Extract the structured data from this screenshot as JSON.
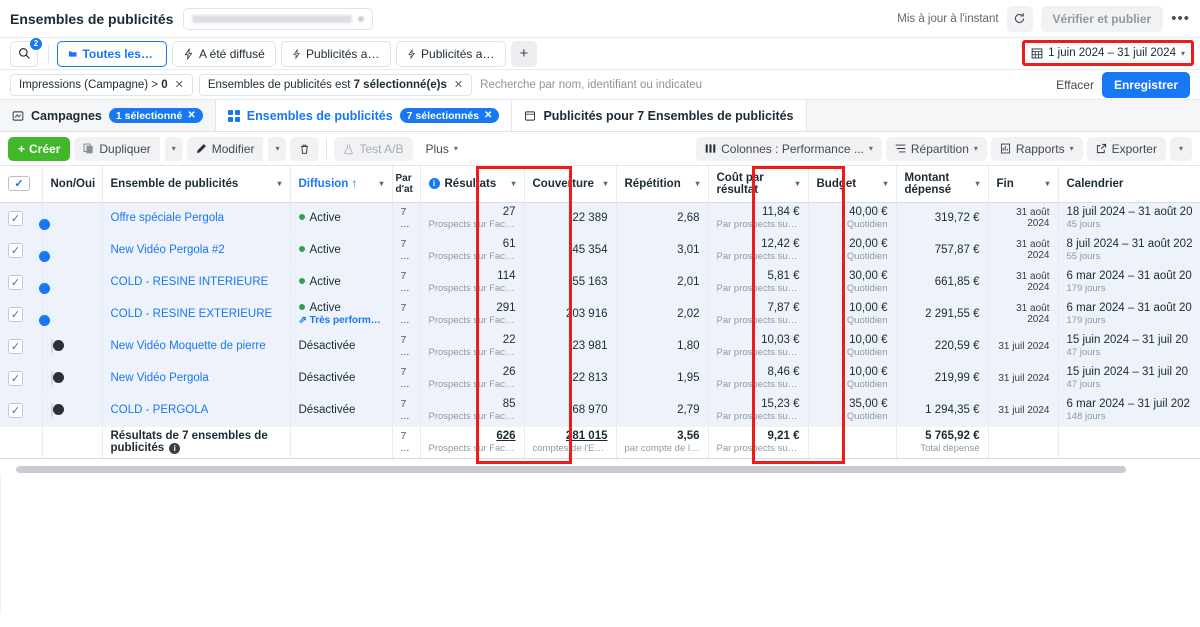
{
  "header": {
    "title": "Ensembles de publicités",
    "account_chip_blurred": true,
    "updated_text": "Mis à jour à l'instant",
    "refresh_icon": "refresh-icon",
    "publish_label": "Vérifier et publier",
    "more_label": "•••"
  },
  "filterbar": {
    "search_icon": "search-icon",
    "search_badge": "2",
    "chips": [
      {
        "icon": "folder-icon",
        "label": "Toutes les pub...",
        "active": true
      },
      {
        "icon": "bolt-icon",
        "label": "A été diffusé",
        "active": false
      },
      {
        "icon": "bolt-icon",
        "label": "Publicités activ...",
        "active": false
      },
      {
        "icon": "bolt-icon",
        "label": "Publicités activ...",
        "active": false
      }
    ],
    "add_label": "+",
    "date_range": {
      "icon": "calendar-icon",
      "label": "1 juin 2024 – 31 juil 2024",
      "caret": "▾",
      "highlighted": true
    }
  },
  "tokenrow": {
    "tokens": [
      {
        "text": "Impressions (Campagne) > ",
        "bold": "0"
      },
      {
        "text": "Ensembles de publicités est ",
        "bold": "7 sélectionné(e)s"
      }
    ],
    "search_placeholder": "Recherche par nom, identifiant ou indicateu",
    "clear_label": "Effacer",
    "save_label": "Enregistrer"
  },
  "tabs": [
    {
      "icon": "campaign-icon",
      "label": "Campagnes",
      "pill": "1 sélectionné",
      "selected": false
    },
    {
      "icon": "adset-grid-icon",
      "label": "Ensembles de publicités",
      "pill": "7 sélectionnés",
      "selected": true
    },
    {
      "icon": "ads-icon",
      "label": "Publicités pour 7 Ensembles de publicités",
      "pill": "",
      "selected": false
    }
  ],
  "toolbar": {
    "create_label": "Créer",
    "duplicate_label": "Dupliquer",
    "edit_label": "Modifier",
    "delete_icon": "trash-icon",
    "ab_test_label": "Test A/B",
    "more_label": "Plus",
    "columns_label": "Colonnes : Performance ...",
    "breakdown_label": "Répartition",
    "reports_label": "Rapports",
    "export_label": "Exporter"
  },
  "table": {
    "columns": [
      {
        "key": "check",
        "label": "",
        "sortable": false
      },
      {
        "key": "onoff",
        "label": "Non/Oui",
        "sortable": false
      },
      {
        "key": "name",
        "label": "Ensemble de publicités",
        "sortable": true
      },
      {
        "key": "delivery",
        "label": "Diffusion ↑",
        "sortable": true,
        "link": true
      },
      {
        "key": "attrib",
        "label": "Par d'at",
        "sortable": false
      },
      {
        "key": "results",
        "label": "Résultats",
        "sortable": true,
        "info": true,
        "highlighted": true
      },
      {
        "key": "reach",
        "label": "Couverture",
        "sortable": true
      },
      {
        "key": "freq",
        "label": "Répétition",
        "sortable": true
      },
      {
        "key": "cpr",
        "label": "Coût par résultat",
        "sortable": true,
        "highlighted": true
      },
      {
        "key": "budget",
        "label": "Budget",
        "sortable": true
      },
      {
        "key": "spent",
        "label": "Montant dépensé",
        "sortable": true
      },
      {
        "key": "end",
        "label": "Fin",
        "sortable": true
      },
      {
        "key": "schedule",
        "label": "Calendrier",
        "sortable": false
      }
    ],
    "rows": [
      {
        "checked": true,
        "toggle": "on",
        "name": "Offre spéciale Pergola",
        "delivery": "Active",
        "delivery_state": "active",
        "badge": "",
        "attrib": "7 ...",
        "results": "27",
        "results_sub": "Prospects sur Face...",
        "reach": "22 389",
        "freq": "2,68",
        "cpr": "11,84 €",
        "cpr_sub": "Par prospects sur F...",
        "budget": "40,00 €",
        "budget_sub": "Quotidien",
        "spent": "319,72 €",
        "end": "31 août 2024",
        "schedule": "18 juil 2024 – 31 août 20",
        "schedule_sub": "45 jours"
      },
      {
        "checked": true,
        "toggle": "on",
        "name": "New Vidéo Pergola #2",
        "delivery": "Active",
        "delivery_state": "active",
        "badge": "",
        "attrib": "7 ...",
        "results": "61",
        "results_sub": "Prospects sur Face...",
        "reach": "45 354",
        "freq": "3,01",
        "cpr": "12,42 €",
        "cpr_sub": "Par prospects sur F...",
        "budget": "20,00 €",
        "budget_sub": "Quotidien",
        "spent": "757,87 €",
        "end": "31 août 2024",
        "schedule": "8 juil 2024 – 31 août 202",
        "schedule_sub": "55 jours"
      },
      {
        "checked": true,
        "toggle": "on",
        "name": "COLD - RESINE INTERIEURE",
        "delivery": "Active",
        "delivery_state": "active",
        "badge": "",
        "attrib": "7 ...",
        "results": "114",
        "results_sub": "Prospects sur Face...",
        "reach": "55 163",
        "freq": "2,01",
        "cpr": "5,81 €",
        "cpr_sub": "Par prospects sur F...",
        "budget": "30,00 €",
        "budget_sub": "Quotidien",
        "spent": "661,85 €",
        "end": "31 août 2024",
        "schedule": "6 mar 2024 – 31 août 20",
        "schedule_sub": "179 jours"
      },
      {
        "checked": true,
        "toggle": "on",
        "name": "COLD - RESINE EXTERIEURE",
        "delivery": "Active",
        "delivery_state": "active",
        "badge": "Très performant(e)",
        "attrib": "7 ...",
        "results": "291",
        "results_sub": "Prospects sur Face...",
        "reach": "203 916",
        "freq": "2,02",
        "cpr": "7,87 €",
        "cpr_sub": "Par prospects sur F...",
        "budget": "10,00 €",
        "budget_sub": "Quotidien",
        "spent": "2 291,55 €",
        "end": "31 août 2024",
        "schedule": "6 mar 2024 – 31 août 20",
        "schedule_sub": "179 jours"
      },
      {
        "checked": true,
        "toggle": "off",
        "name": "New Vidéo Moquette de pierre",
        "delivery": "Désactivée",
        "delivery_state": "off",
        "badge": "",
        "attrib": "7 ...",
        "results": "22",
        "results_sub": "Prospects sur Face...",
        "reach": "23 981",
        "freq": "1,80",
        "cpr": "10,03 €",
        "cpr_sub": "Par prospects sur F...",
        "budget": "10,00 €",
        "budget_sub": "Quotidien",
        "spent": "220,59 €",
        "end": "31 juil 2024",
        "schedule": "15 juin 2024 – 31 juil 20",
        "schedule_sub": "47 jours"
      },
      {
        "checked": true,
        "toggle": "off",
        "name": "New Vidéo Pergola",
        "delivery": "Désactivée",
        "delivery_state": "off",
        "badge": "",
        "attrib": "7 ...",
        "results": "26",
        "results_sub": "Prospects sur Face...",
        "reach": "22 813",
        "freq": "1,95",
        "cpr": "8,46 €",
        "cpr_sub": "Par prospects sur F...",
        "budget": "10,00 €",
        "budget_sub": "Quotidien",
        "spent": "219,99 €",
        "end": "31 juil 2024",
        "schedule": "15 juin 2024 – 31 juil 20",
        "schedule_sub": "47 jours"
      },
      {
        "checked": true,
        "toggle": "off",
        "name": "COLD - PERGOLA",
        "delivery": "Désactivée",
        "delivery_state": "off",
        "badge": "",
        "attrib": "7 ...",
        "results": "85",
        "results_sub": "Prospects sur Face...",
        "reach": "68 970",
        "freq": "2,79",
        "cpr": "15,23 €",
        "cpr_sub": "Par prospects sur F...",
        "budget": "35,00 €",
        "budget_sub": "Quotidien",
        "spent": "1 294,35 €",
        "end": "31 juil 2024",
        "schedule": "6 mar 2024 – 31 juil 202",
        "schedule_sub": "148 jours"
      }
    ],
    "total_row": {
      "label": "Résultats de 7 ensembles de publicités",
      "attrib": "7 ...",
      "results": "626",
      "results_sub": "Prospects sur Face...",
      "reach": "281 015",
      "reach_sub": "comptes de l'Espac...",
      "freq": "3,56",
      "freq_sub": "par compte de l'Esp...",
      "cpr": "9,21 €",
      "cpr_sub": "Par prospects sur F...",
      "budget": "",
      "budget_sub": "",
      "spent": "5 765,92 €",
      "spent_sub": "Total dépensé",
      "end": "",
      "schedule": ""
    }
  },
  "colors": {
    "accent": "#1877f2",
    "green": "#42b72a",
    "highlight": "#ef1b1b",
    "row_bg": "#eef2fa",
    "active_dot": "#31a24c"
  }
}
